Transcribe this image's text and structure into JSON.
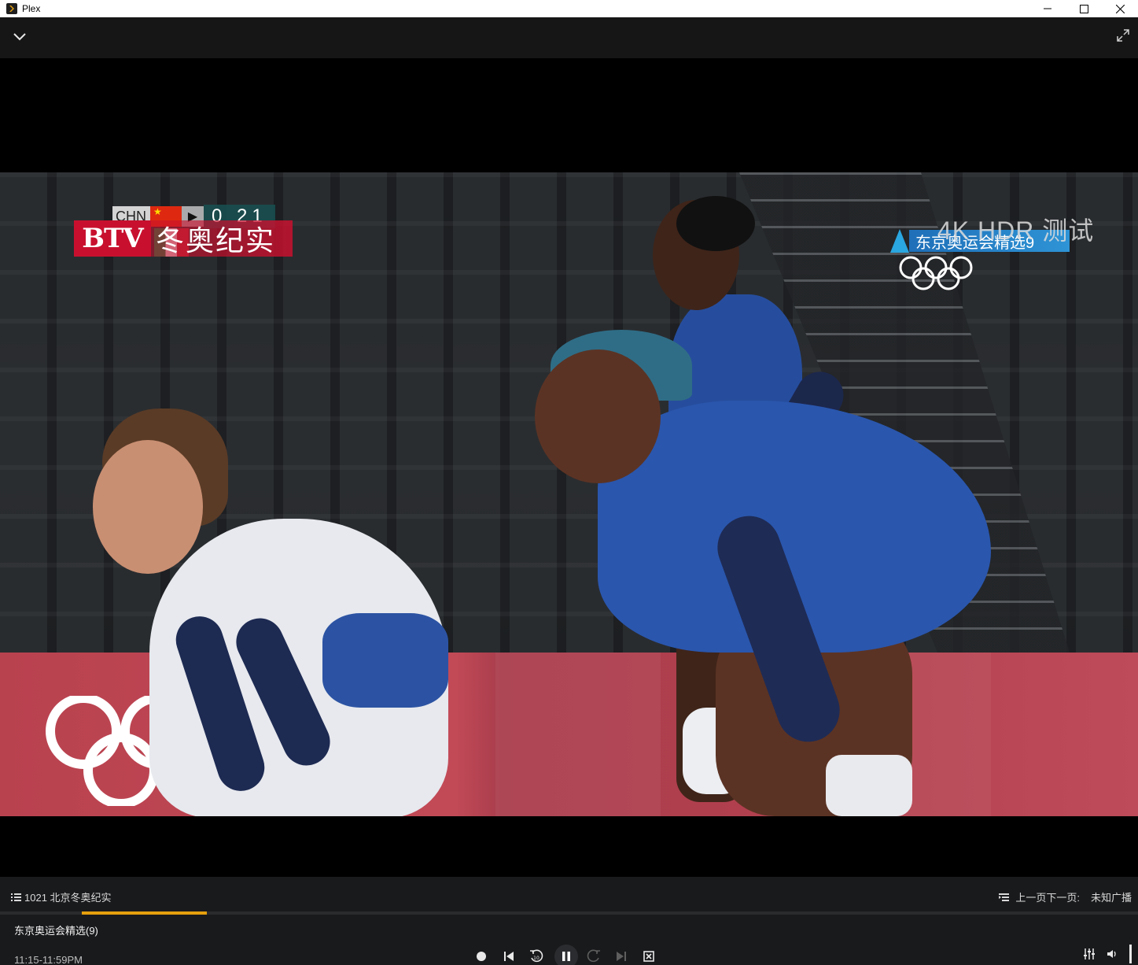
{
  "window": {
    "title": "Plex",
    "app_icon": "plex-logo"
  },
  "overlay": {
    "score_team": "CHN",
    "score_value": "0 21",
    "channel_logo": "BTV",
    "channel_name": "冬奥纪实",
    "quality_text": "4K HDR 测试",
    "program_banner": "东京奥运会精选9"
  },
  "controls": {
    "queue_label": "1021 北京冬奥纪实",
    "nav_label": "上一页下一页:",
    "broadcast_label": "未知广播",
    "program_title": "东京奥运会精选(9)",
    "program_time": "11:15-11:59PM",
    "progress_fraction": 0.11,
    "accent_color": "#e5a00d"
  },
  "icons": {
    "collapse": "chevron-down-icon",
    "fullscreen": "expand-icon",
    "record": "record-icon",
    "previous": "skip-previous-icon",
    "rewind": "replay-10-icon",
    "pause": "pause-icon",
    "forward": "forward-icon",
    "next": "skip-next-icon",
    "stop": "stop-icon",
    "settings": "equalizer-icon",
    "volume": "volume-icon"
  }
}
